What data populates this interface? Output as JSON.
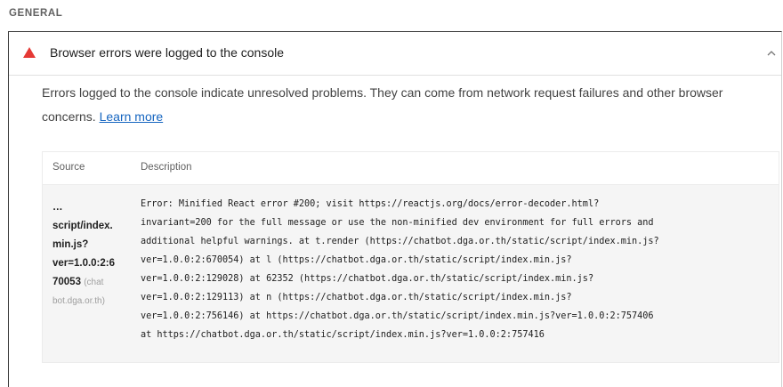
{
  "section": {
    "title": "GENERAL"
  },
  "audit": {
    "title": "Browser errors were logged to the console",
    "status_color": "#e53935",
    "expanded": true,
    "description": "Errors logged to the console indicate unresolved problems. They can come from network request failures and other browser concerns.",
    "learn_more_label": "Learn more",
    "table": {
      "headers": {
        "source": "Source",
        "description": "Description"
      },
      "rows": [
        {
          "source_path": "…\nscript/index.\nmin.js?\nver=1.0.0:2:6\n70053",
          "source_domain": "(chat\nbot.dga.or.th)",
          "description": "Error: Minified React error #200; visit https://reactjs.org/docs/error-decoder.html?\ninvariant=200 for the full message or use the non-minified dev environment for full errors and\nadditional helpful warnings. at t.render (https://chatbot.dga.or.th/static/script/index.min.js?\nver=1.0.0:2:670054) at l (https://chatbot.dga.or.th/static/script/index.min.js?\nver=1.0.0:2:129028) at 62352 (https://chatbot.dga.or.th/static/script/index.min.js?\nver=1.0.0:2:129113) at n (https://chatbot.dga.or.th/static/script/index.min.js?\nver=1.0.0:2:756146) at https://chatbot.dga.or.th/static/script/index.min.js?ver=1.0.0:2:757406\nat https://chatbot.dga.or.th/static/script/index.min.js?ver=1.0.0:2:757416"
        }
      ]
    }
  },
  "icons": {
    "status": "fail-triangle-icon",
    "toggle": "chevron-up-icon"
  }
}
